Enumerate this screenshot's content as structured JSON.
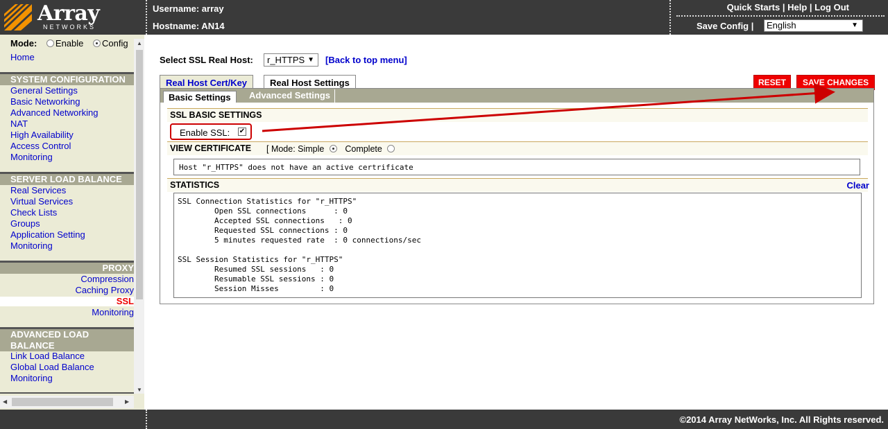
{
  "header": {
    "logo_text": "Array",
    "logo_sub": "NETWORKS",
    "username_label": "Username: array",
    "hostname_label": "Hostname: AN14",
    "links": [
      "Quick Starts",
      "Help",
      "Log Out"
    ],
    "separator": "|",
    "save_config": "Save Config",
    "language": "English"
  },
  "sidebar": {
    "mode_label": "Mode:",
    "mode_options": [
      "Enable",
      "Config"
    ],
    "mode_selected": "Config",
    "home": "Home",
    "system_configuration": {
      "title": "SYSTEM CONFIGURATION",
      "items": [
        "General Settings",
        "Basic Networking",
        "Advanced Networking",
        "NAT",
        "High Availability",
        "Access Control",
        "Monitoring"
      ]
    },
    "server_load_balance": {
      "title": "SERVER LOAD BALANCE",
      "items": [
        "Real Services",
        "Virtual Services",
        "Check Lists",
        "Groups",
        "Application Setting",
        "Monitoring"
      ]
    },
    "proxy": {
      "title": "PROXY",
      "items": [
        "Compression",
        "Caching Proxy",
        "SSL",
        "Monitoring"
      ],
      "active": "SSL"
    },
    "advanced_load_balance": {
      "title_line1": "ADVANCED LOAD",
      "title_line2": "BALANCE",
      "items": [
        "Link Load Balance",
        "Global Load Balance",
        "Monitoring"
      ]
    }
  },
  "main": {
    "select_label": "Select SSL Real Host:",
    "host_value": "r_HTTPS",
    "back_link": "[Back to top menu]",
    "tabs": [
      "Real Host Cert/Key",
      "Real Host Settings"
    ],
    "active_tab": "Real Host Settings",
    "reset_button": "RESET",
    "save_button": "SAVE CHANGES",
    "subtabs": [
      "Basic Settings",
      "Advanced Settings"
    ],
    "active_subtab": "Basic Settings",
    "ssl_basic_title": "SSL BASIC SETTINGS",
    "enable_ssl_label": "Enable SSL:",
    "enable_ssl_checked": true,
    "view_cert_title": "VIEW CERTIFICATE",
    "cert_mode_prefix": "[ Mode: Simple",
    "cert_mode_complete": "Complete",
    "cert_mode_selected": "Simple",
    "cert_message": "Host \"r_HTTPS\" does not have an active certrificate",
    "statistics_title": "STATISTICS",
    "clear_link": "Clear",
    "statistics_text": "SSL Connection Statistics for \"r_HTTPS\"\n        Open SSL connections      : 0\n        Accepted SSL connections   : 0\n        Requested SSL connections : 0\n        5 minutes requested rate  : 0 connections/sec\n\nSSL Session Statistics for \"r_HTTPS\"\n        Resumed SSL sessions   : 0\n        Resumable SSL sessions : 0\n        Session Misses         : 0"
  },
  "footer": {
    "copyright": "©2014 Array NetWorks, Inc. All Rights reserved."
  },
  "colors": {
    "header_bg": "#3a3a3a",
    "sidebar_bg": "#ebebd6",
    "section_header_bg": "#a8a892",
    "link": "#0000cc",
    "accent_red": "#ee0000",
    "annotation_red": "#cc0000"
  }
}
